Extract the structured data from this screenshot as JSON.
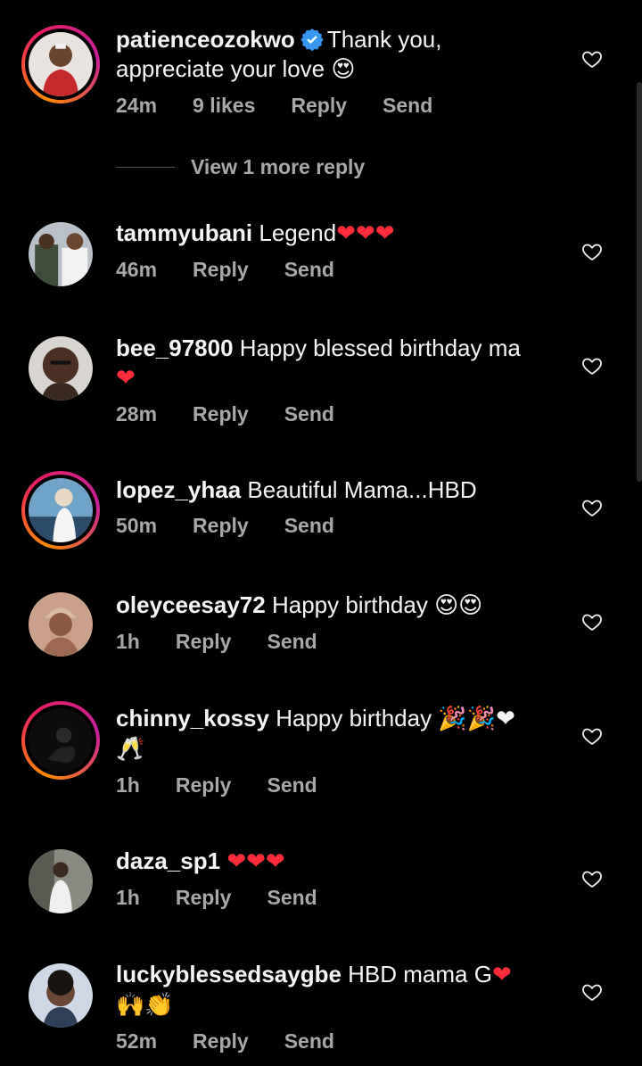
{
  "comments": [
    {
      "username": "patienceozokwo",
      "verified": true,
      "text": "Thank you,",
      "text2": "appreciate your love",
      "emoji": "😍",
      "time": "24m",
      "likes": "9 likes",
      "reply": "Reply",
      "send": "Send"
    },
    {
      "username": "tammyubani",
      "text": "Legend",
      "emoji": "❤❤❤",
      "time": "46m",
      "reply": "Reply",
      "send": "Send"
    },
    {
      "username": "bee_97800",
      "text": "Happy blessed birthday ma",
      "emoji": "❤",
      "time": "28m",
      "reply": "Reply",
      "send": "Send"
    },
    {
      "username": "lopez_yhaa",
      "text": "Beautiful Mama...HBD",
      "time": "50m",
      "reply": "Reply",
      "send": "Send"
    },
    {
      "username": "oleyceesay72",
      "text": "Happy birthday",
      "emoji": "😍😍",
      "time": "1h",
      "reply": "Reply",
      "send": "Send"
    },
    {
      "username": "chinny_kossy",
      "text": "Happy birthday",
      "emoji": "🎉🎉❤",
      "emoji2": "🥂",
      "time": "1h",
      "reply": "Reply",
      "send": "Send"
    },
    {
      "username": "daza_sp1",
      "text": "",
      "emoji": "❤❤❤",
      "time": "1h",
      "reply": "Reply",
      "send": "Send"
    },
    {
      "username": "luckyblessedsaygbe",
      "text": "HBD mama G",
      "emoji": "❤",
      "emoji2": "🙌👏",
      "time": "52m",
      "reply": "Reply",
      "send": "Send"
    }
  ],
  "view_more_replies": "View 1 more reply",
  "colors": {
    "background": "#000000",
    "secondary_text": "#a8a8a8",
    "verified_blue": "#3897f0",
    "heart_red": "#ff2d3b"
  },
  "icons": {
    "like": "heart-outline-icon",
    "verified": "verified-badge-icon"
  }
}
